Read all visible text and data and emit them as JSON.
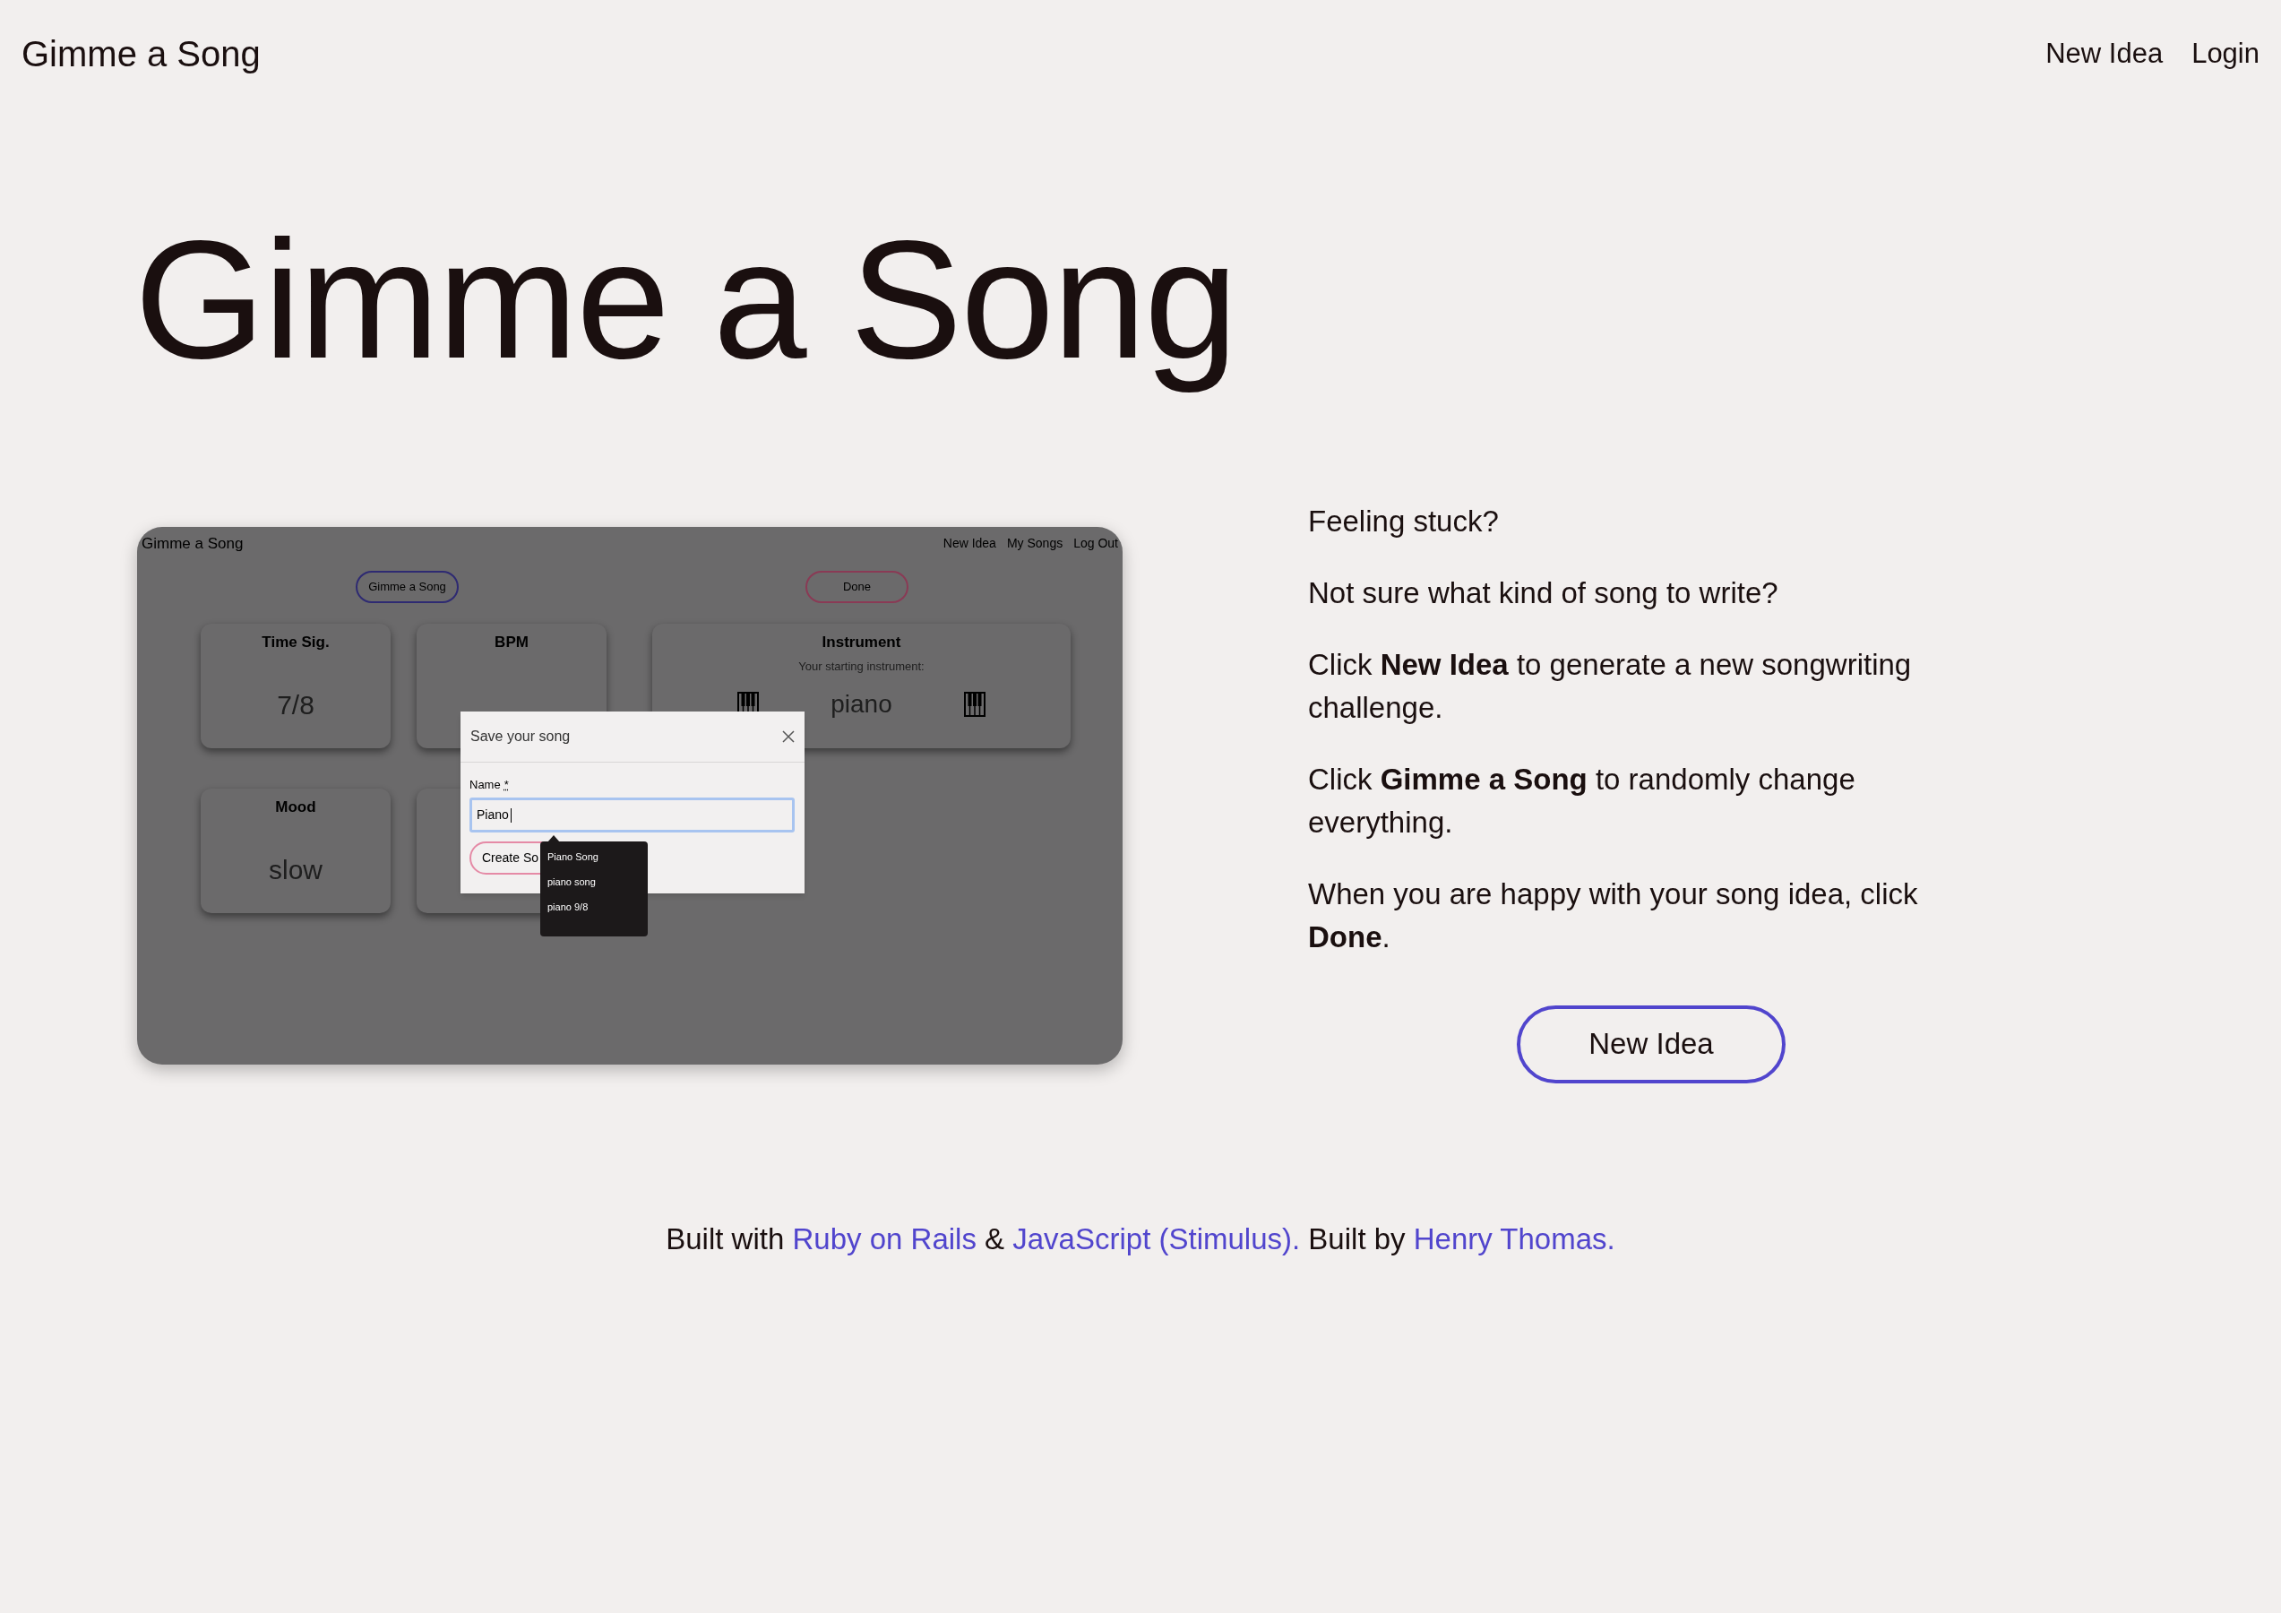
{
  "header": {
    "brand": "Gimme a Song",
    "nav": [
      "New Idea",
      "Login"
    ]
  },
  "hero_title": "Gimme a Song",
  "preview": {
    "brand": "Gimme a Song",
    "nav": [
      "New Idea",
      "My Songs",
      "Log Out"
    ],
    "buttons": [
      {
        "label": "Gimme a Song",
        "kind": "primary"
      },
      {
        "label": "Done",
        "kind": "done"
      }
    ],
    "cards": [
      {
        "kind": "value",
        "title": "Time Sig.",
        "value": "7/8"
      },
      {
        "kind": "value",
        "title": "BPM"
      },
      {
        "kind": "instrument",
        "title": "Instrument",
        "subtitle": "Your starting instrument:",
        "value": "piano"
      },
      {
        "kind": "value",
        "title": "Mood",
        "value": "slow"
      },
      {
        "kind": "blank"
      }
    ],
    "modal": {
      "title": "Save your song",
      "label": "Name",
      "required_mark": "*",
      "value": "Piano",
      "button": "Create So",
      "suggestions": [
        "Piano Song",
        "piano song",
        "piano 9/8"
      ]
    }
  },
  "intro": [
    "Feeling stuck?",
    "Not sure what kind of song to write?",
    "Click **New Idea** to generate a new songwriting challenge.",
    "Click **Gimme a Song** to randomly change everything.",
    "When you are happy with your song idea, click **Done**."
  ],
  "cta": "New Idea",
  "footer": [
    {
      "kind": "text",
      "text": "Built with "
    },
    {
      "kind": "link",
      "text": "Ruby on Rails"
    },
    {
      "kind": "text",
      "text": " & "
    },
    {
      "kind": "link",
      "text": "JavaScript (Stimulus)."
    },
    {
      "kind": "text",
      "text": " Built by "
    },
    {
      "kind": "link",
      "text": "Henry Thomas."
    }
  ]
}
